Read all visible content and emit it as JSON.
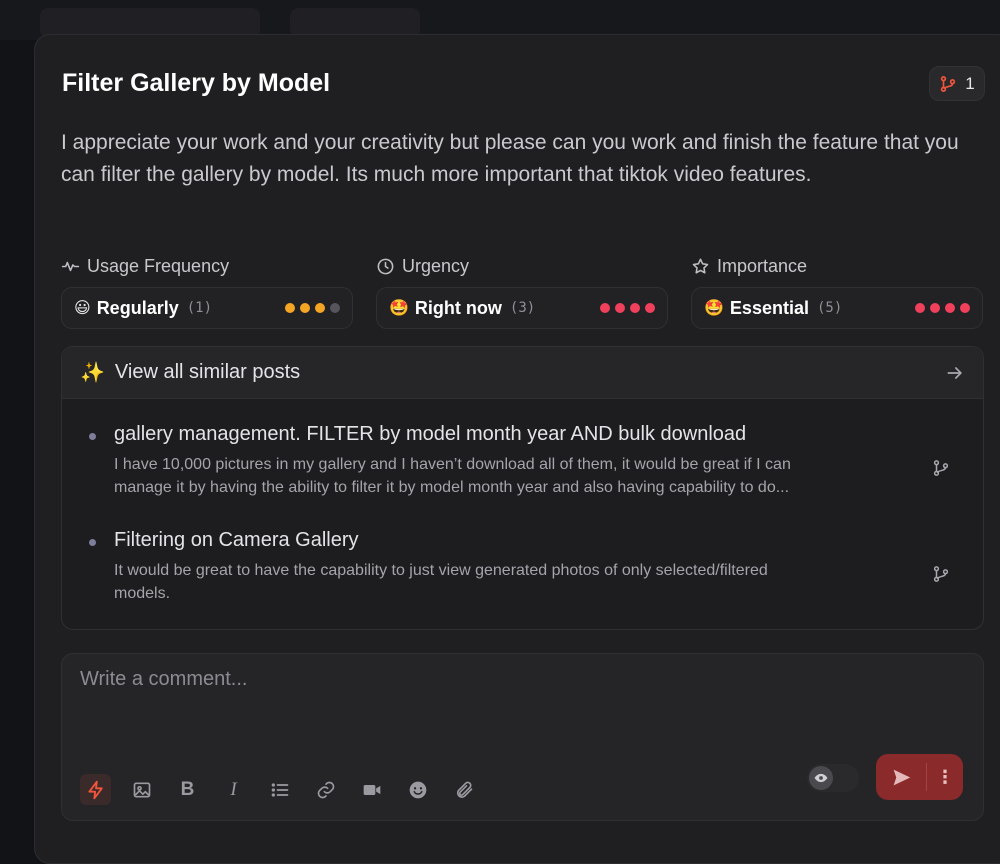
{
  "modal": {
    "title": "Filter Gallery by Model",
    "vote_count": "1",
    "description": "I appreciate your work and your creativity but please can you work and finish the feature that you can filter the gallery by model. Its much more important that tiktok video features."
  },
  "metrics": [
    {
      "label": "Usage Frequency",
      "icon": "activity-icon",
      "emoji": "😃",
      "value": "Regularly",
      "count": "(1)",
      "level": 3,
      "max_level": 4,
      "color": "#f5a524"
    },
    {
      "label": "Urgency",
      "icon": "clock-icon",
      "emoji": "🤩",
      "value": "Right now",
      "count": "(3)",
      "level": 4,
      "max_level": 4,
      "color": "#f0405c"
    },
    {
      "label": "Importance",
      "icon": "star-icon",
      "emoji": "🤩",
      "value": "Essential",
      "count": "(5)",
      "level": 4,
      "max_level": 4,
      "color": "#f0405c"
    }
  ],
  "similar": {
    "header": "View all similar posts",
    "posts": [
      {
        "title": "gallery management. FILTER by model month year AND bulk download",
        "desc_line1": "I have 10,000 pictures in my gallery and I haven’t download all of them, it would be great if I can",
        "desc_line2": "manage it by having the ability to filter it by model month year and also having capability to do..."
      },
      {
        "title": "Filtering on Camera Gallery",
        "desc_line1": "It would be great to have the capability to just view generated photos of only selected/filtered",
        "desc_line2": "models."
      }
    ]
  },
  "comment": {
    "placeholder": "Write a comment...",
    "tools": [
      "lightning-icon",
      "image-icon",
      "bold-icon",
      "italic-icon",
      "list-icon",
      "link-icon",
      "video-icon",
      "emoji-icon",
      "attachment-icon"
    ],
    "bold_label": "B",
    "italic_label": "I",
    "more_label": "⋮"
  },
  "colors": {
    "accent": "#f0405c",
    "warning": "#f5a524",
    "inactive_dot": "#55555b"
  }
}
